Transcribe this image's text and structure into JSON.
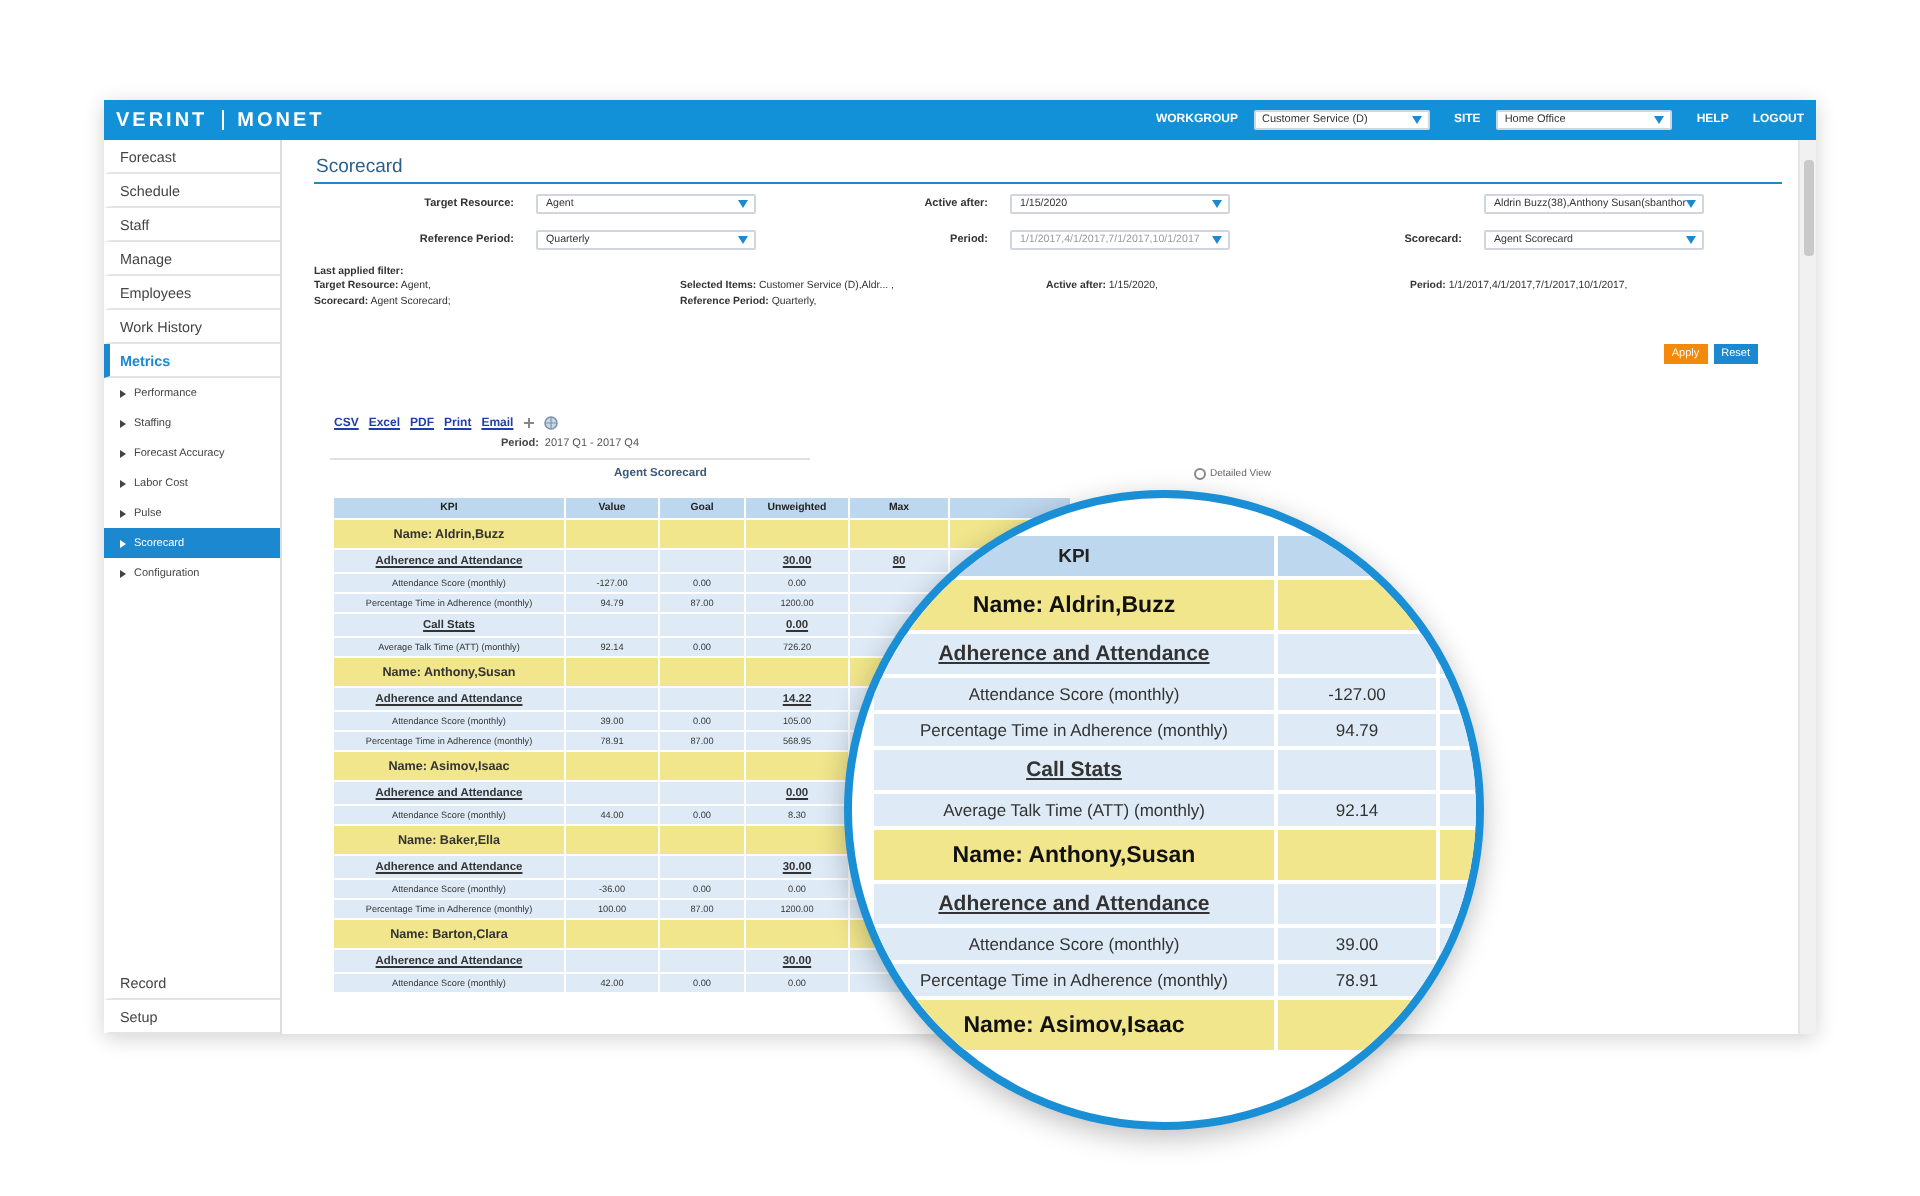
{
  "topbar": {
    "logo": "VERINT",
    "product": "MONET",
    "workgroup_label": "WORKGROUP",
    "workgroup": "Customer Service (D)",
    "site_label": "SITE",
    "site": "Home Office",
    "links": [
      "HELP",
      "LOGOUT"
    ]
  },
  "sidebar": {
    "items": [
      {
        "label": "Forecast",
        "selected": false
      },
      {
        "label": "Schedule",
        "selected": false
      },
      {
        "label": "Staff",
        "selected": false
      },
      {
        "label": "Manage",
        "selected": false
      },
      {
        "label": "Employees",
        "selected": false
      },
      {
        "label": "Work History",
        "selected": false
      },
      {
        "label": "Metrics",
        "selected": true,
        "children": [
          {
            "label": "Performance",
            "selected": false
          },
          {
            "label": "Staffing",
            "selected": false
          },
          {
            "label": "Forecast Accuracy",
            "selected": false
          },
          {
            "label": "Labor Cost",
            "selected": false
          },
          {
            "label": "Pulse",
            "selected": false
          },
          {
            "label": "Scorecard",
            "selected": true
          },
          {
            "label": "Configuration",
            "selected": false
          }
        ]
      }
    ],
    "bottom_items": [
      {
        "label": "Record",
        "selected": false
      },
      {
        "label": "Setup",
        "selected": false
      }
    ]
  },
  "page_title": "Scorecard",
  "filters": [
    {
      "label": "Target Resource:",
      "value": "Agent",
      "disabled": false
    },
    {
      "label": "Active after:",
      "value": "1/15/2020",
      "disabled": false
    },
    {
      "value": "Aldrin Buzz(38),Anthony Susan(sbanthor",
      "disabled": false
    },
    {
      "label": "Reference Period:",
      "value": "Quarterly",
      "disabled": false
    },
    {
      "label": "Period:",
      "value": "1/1/2017,4/1/2017,7/1/2017,10/1/2017",
      "disabled": true
    },
    {
      "label": "Scorecard:",
      "value": "Agent Scorecard",
      "disabled": false
    }
  ],
  "last_applied": {
    "title": "Last applied filter:",
    "columns": [
      [
        "**Target Resource:** Agent,",
        "**Scorecard:** Agent Scorecard;"
      ],
      [
        "**Selected Items:** Customer Service (D),Aldr... ,",
        "**Reference Period:** Quarterly,"
      ],
      [
        "**Active after:** 1/15/2020,"
      ],
      [
        "**Period:** 1/1/2017,4/1/2017,7/1/2017,10/1/2017,"
      ]
    ]
  },
  "actions": [
    "Apply",
    "Reset"
  ],
  "export_links": [
    "CSV",
    "Excel",
    "PDF",
    "Print",
    "Email"
  ],
  "period": {
    "label": "Period:",
    "value": "2017 Q1 - 2017 Q4"
  },
  "report_title": "Agent Scorecard",
  "view_options": [
    {
      "label": "Detailed View",
      "selected": false
    }
  ],
  "table": {
    "columns": [
      "KPI",
      "Value",
      "Goal",
      "Unweighted",
      "Max"
    ],
    "rows": [
      {
        "kind": "name",
        "kpi": "Name: Aldrin,Buzz"
      },
      {
        "kind": "section",
        "kpi": "Adherence and Attendance",
        "unweighted": "30.00",
        "max": "80"
      },
      {
        "kind": "data",
        "kpi": "Attendance Score (monthly)",
        "value": "-127.00",
        "goal": "0.00",
        "unweighted": "0.00"
      },
      {
        "kind": "data",
        "kpi": "Percentage Time in Adherence (monthly)",
        "value": "94.79",
        "goal": "87.00",
        "unweighted": "1200.00"
      },
      {
        "kind": "section",
        "kpi": "Call Stats",
        "unweighted": "0.00"
      },
      {
        "kind": "data",
        "kpi": "Average Talk Time (ATT) (monthly)",
        "value": "92.14",
        "goal": "0.00",
        "unweighted": "726.20"
      },
      {
        "kind": "name",
        "kpi": "Name: Anthony,Susan"
      },
      {
        "kind": "section",
        "kpi": "Adherence and Attendance",
        "unweighted": "14.22"
      },
      {
        "kind": "data",
        "kpi": "Attendance Score (monthly)",
        "value": "39.00",
        "goal": "0.00",
        "unweighted": "105.00"
      },
      {
        "kind": "data",
        "kpi": "Percentage Time in Adherence (monthly)",
        "value": "78.91",
        "goal": "87.00",
        "unweighted": "568.95"
      },
      {
        "kind": "name",
        "kpi": "Name: Asimov,Isaac"
      },
      {
        "kind": "section",
        "kpi": "Adherence and Attendance",
        "unweighted": "0.00"
      },
      {
        "kind": "data",
        "kpi": "Attendance Score (monthly)",
        "value": "44.00",
        "goal": "0.00",
        "unweighted": "8.30"
      },
      {
        "kind": "name",
        "kpi": "Name: Baker,Ella"
      },
      {
        "kind": "section",
        "kpi": "Adherence and Attendance",
        "unweighted": "30.00"
      },
      {
        "kind": "data",
        "kpi": "Attendance Score (monthly)",
        "value": "-36.00",
        "goal": "0.00",
        "unweighted": "0.00"
      },
      {
        "kind": "data",
        "kpi": "Percentage Time in Adherence (monthly)",
        "value": "100.00",
        "goal": "87.00",
        "unweighted": "1200.00"
      },
      {
        "kind": "name",
        "kpi": "Name: Barton,Clara"
      },
      {
        "kind": "section",
        "kpi": "Adherence and Attendance",
        "unweighted": "30.00"
      },
      {
        "kind": "data",
        "kpi": "Attendance Score (monthly)",
        "value": "42.00",
        "goal": "0.00",
        "unweighted": "0.00"
      }
    ]
  },
  "magnifier": {
    "header": "KPI",
    "rows": [
      {
        "kind": "name",
        "kpi": "Name: Aldrin,Buzz"
      },
      {
        "kind": "section",
        "kpi": "Adherence and Attendance"
      },
      {
        "kind": "data",
        "kpi": "Attendance Score (monthly)",
        "value": "-127.00"
      },
      {
        "kind": "data",
        "kpi": "Percentage Time in Adherence (monthly)",
        "value": "94.79"
      },
      {
        "kind": "section",
        "kpi": "Call Stats"
      },
      {
        "kind": "data",
        "kpi": "Average Talk Time (ATT) (monthly)",
        "value": "92.14"
      },
      {
        "kind": "name",
        "kpi": "Name: Anthony,Susan"
      },
      {
        "kind": "section",
        "kpi": "Adherence and Attendance"
      },
      {
        "kind": "data",
        "kpi": "Attendance Score (monthly)",
        "value": "39.00"
      },
      {
        "kind": "data",
        "kpi": "Percentage Time in Adherence (monthly)",
        "value": "78.91"
      },
      {
        "kind": "name",
        "kpi": "Name: Asimov,Isaac"
      }
    ]
  }
}
